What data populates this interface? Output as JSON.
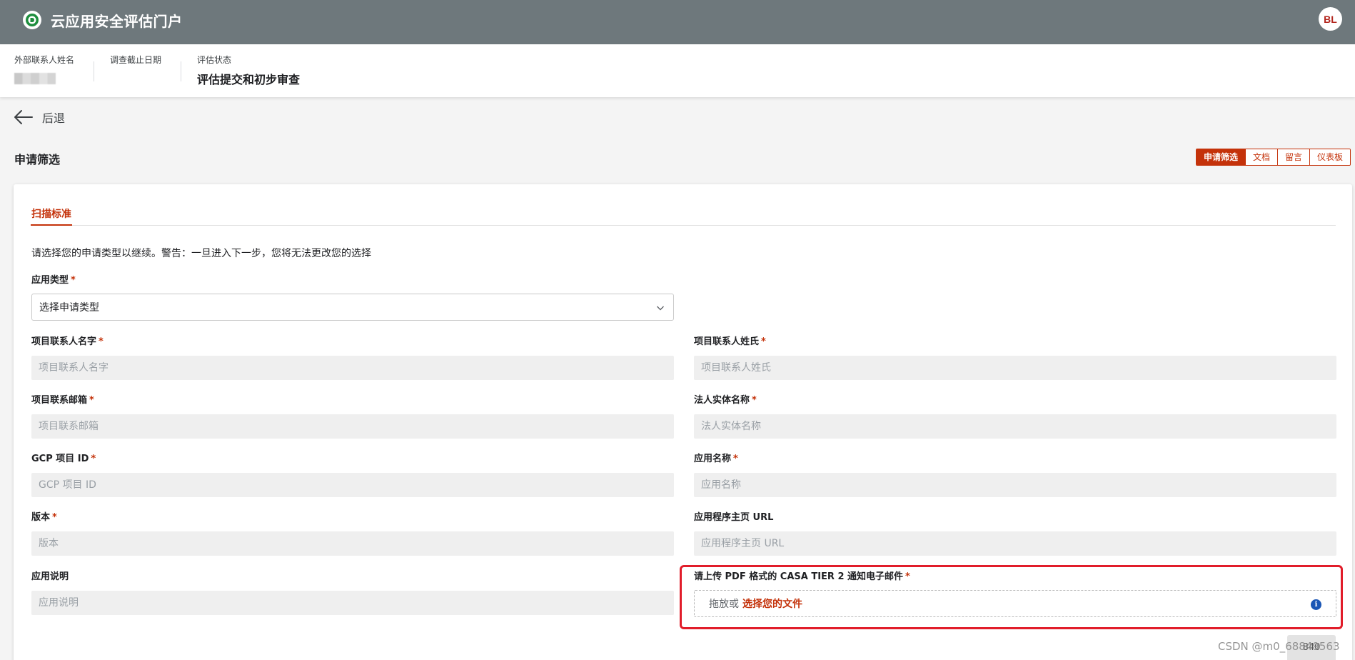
{
  "app": {
    "title": "云应用安全评估门户",
    "logo_icon": "casa-logo-icon",
    "user_initials": "BL"
  },
  "info_strip": {
    "contact": {
      "label": "外部联系人姓名",
      "value": ""
    },
    "deadline": {
      "label": "调查截止日期",
      "value": ""
    },
    "status": {
      "label": "评估状态",
      "value": "评估提交和初步审查"
    }
  },
  "back": {
    "label": "后退",
    "icon": "arrow-left-icon"
  },
  "section": {
    "title": "申请筛选"
  },
  "segments": [
    {
      "label": "申请筛选",
      "active": true
    },
    {
      "label": "文档",
      "active": false
    },
    {
      "label": "留言",
      "active": false
    },
    {
      "label": "仪表板",
      "active": false
    }
  ],
  "form": {
    "tab": "扫描标准",
    "intro": "请选择您的申请类型以继续。警告：一旦进入下一步，您将无法更改您的选择",
    "app_type": {
      "label": "应用类型",
      "required": "*",
      "value": "选择申请类型"
    },
    "first_name": {
      "label": "项目联系人名字",
      "required": "*",
      "placeholder": "项目联系人名字"
    },
    "last_name": {
      "label": "项目联系人姓氏",
      "required": "*",
      "placeholder": "项目联系人姓氏"
    },
    "email": {
      "label": "项目联系邮箱",
      "required": "*",
      "placeholder": "项目联系邮箱"
    },
    "legal_entity": {
      "label": "法人实体名称",
      "required": "*",
      "placeholder": "法人实体名称"
    },
    "gcp_id": {
      "label": "GCP 项目 ID",
      "required": "*",
      "placeholder": "GCP 项目 ID"
    },
    "app_name": {
      "label": "应用名称",
      "required": "*",
      "placeholder": "应用名称"
    },
    "version": {
      "label": "版本",
      "required": "*",
      "placeholder": "版本"
    },
    "homepage": {
      "label": "应用程序主页 URL",
      "placeholder": "应用程序主页 URL"
    },
    "description": {
      "label": "应用说明",
      "placeholder": "应用说明"
    },
    "upload": {
      "label": "请上传 PDF 格式的 CASA TIER 2 通知电子邮件",
      "required": "*",
      "drop_text": "拖放或",
      "choose_text": "选择您的文件",
      "info_icon": "info-icon"
    }
  },
  "colors": {
    "appbar": "#6e787c",
    "accent": "#c4320a",
    "highlight": "#e11d2a",
    "info": "#1a56b5"
  },
  "watermark": {
    "text": "CSDN @m0_68849563",
    "chip": "840"
  }
}
